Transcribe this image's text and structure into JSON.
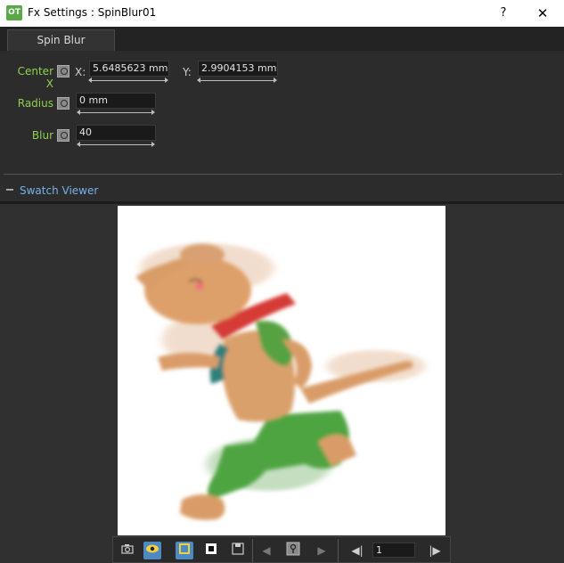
{
  "window": {
    "app_icon_text": "OT",
    "title": "Fx Settings : SpinBlur01",
    "help_label": "?",
    "close_label": "✕"
  },
  "tabs": [
    {
      "label": "Spin Blur"
    }
  ],
  "params": {
    "center": {
      "label": "Center X",
      "x_label": "X:",
      "x_value": "5.6485623 mm",
      "y_label": "Y:",
      "y_value": "2.9904153 mm"
    },
    "radius": {
      "label": "Radius",
      "value": "0 mm"
    },
    "blur": {
      "label": "Blur",
      "value": "40"
    }
  },
  "swatch": {
    "collapse_label": "−",
    "title": "Swatch Viewer"
  },
  "toolbar": {
    "camera_icon": "camera-icon",
    "eye_icon": "eye-icon",
    "frame_value": "1",
    "prev_label": "◀",
    "next_label": "▶",
    "first_label": "◀|",
    "last_label": "|▶"
  },
  "colors": {
    "accent_label": "#8fd14f",
    "swatch_title": "#74b3e8",
    "active_button": "#4d8ac3"
  }
}
